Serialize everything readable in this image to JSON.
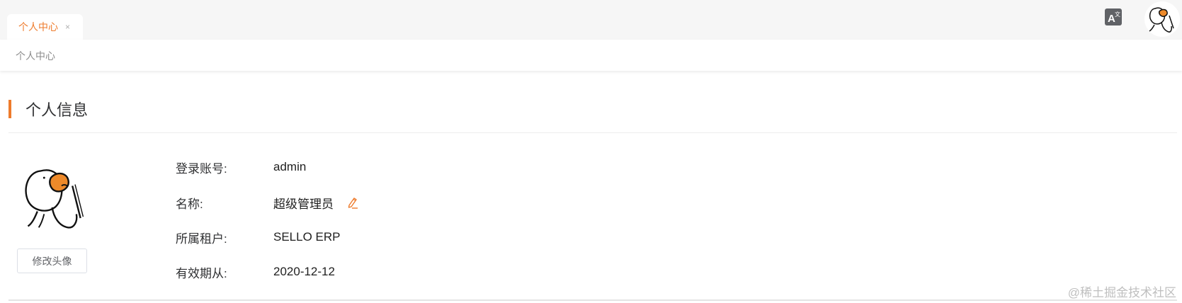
{
  "tabs": [
    {
      "label": "个人中心",
      "close": "×",
      "active": true
    }
  ],
  "breadcrumb": "个人中心",
  "section_title": "个人信息",
  "avatar_button": "修改头像",
  "info": [
    {
      "label": "登录账号:",
      "value": "admin"
    },
    {
      "label": "名称:",
      "value": "超级管理员"
    },
    {
      "label": "所属租户:",
      "value": "SELLO ERP"
    },
    {
      "label": "有效期从:",
      "value": "2020-12-12"
    }
  ],
  "icons": {
    "lang": "translate-icon",
    "edit": "pencil-edit-icon",
    "avatar": "duck-avatar"
  },
  "colors": {
    "accent": "#ee7b2c",
    "topbar_bg": "#f6f6f6"
  },
  "watermark": "@稀土掘金技术社区"
}
